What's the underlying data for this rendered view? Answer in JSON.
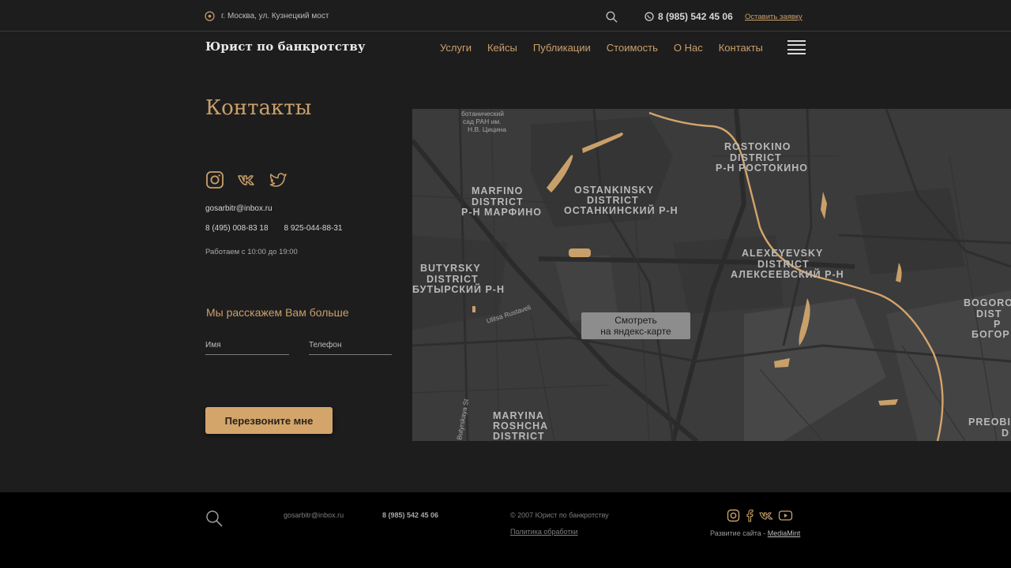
{
  "topbar": {
    "address": "г. Москва, ул. Кузнецкий мост",
    "phone": "8 (985) 542 45 06",
    "request_link": "Оставить заявку"
  },
  "header": {
    "logo": "Юрист по банкротству",
    "nav": [
      "Услуги",
      "Кейсы",
      "Публикации",
      "Стоимость",
      "О Нас",
      "Контакты"
    ]
  },
  "contacts": {
    "title": "Контакты",
    "email": "gosarbitr@inbox.ru",
    "phone1": "8 (495) 008-83 18",
    "phone2": "8 925-044-88-31",
    "hours": "Работаем с 10:00  до 19:00"
  },
  "form": {
    "title": "Мы расскажем Вам больше",
    "name_placeholder": "Имя",
    "phone_placeholder": "Телефон",
    "submit_label": "Перезвоните мне"
  },
  "map": {
    "button_line1": "Смотреть",
    "button_line2": "на яндекс-карте",
    "labels": {
      "botanic": [
        "ботанический",
        "сад РАН им.",
        "Н.В. Цицина"
      ],
      "marfino": [
        "MARFINO",
        "DISTRICT",
        "Р-Н МАРФИНО"
      ],
      "ostankinsky": [
        "OSTANKINSKY",
        "DISTRICT",
        "ОСТАНКИНСКИЙ Р-Н"
      ],
      "rostokino": [
        "ROSTOKINO",
        "DISTRICT",
        "Р-Н РОСТОКИНО"
      ],
      "alexeyevsky": [
        "ALEXEYEVSKY",
        "DISTRICT",
        "АЛЕКСЕЕВСКИЙ Р-Н"
      ],
      "butyrsky": [
        "BUTYRSKY",
        "DISTRICT",
        "БУТЫРСКИЙ Р-Н"
      ],
      "bogorodskoye": [
        "BOGORO",
        "DIST",
        "Р",
        "БОГОР"
      ],
      "maryina": [
        "MARYINA",
        "ROSHCHA",
        "DISTRICT"
      ],
      "preobr": [
        "PREOBI",
        "D"
      ],
      "streets": [
        "Ulitsa Rustaveli",
        "Butyrskaya St"
      ]
    }
  },
  "footer": {
    "email": "gosarbitr@inbox.ru",
    "phone": "8 (985) 542 45 06",
    "copyright": "© 2007 Юрист по банкротству",
    "policy": "Политика обработки",
    "dev_prefix": "Развитие сайта - ",
    "dev_link": "MediaMint"
  },
  "colors": {
    "accent": "#c9a06a",
    "background": "#1e1d1e",
    "footer": "#000000",
    "map": "#3b3b3b"
  }
}
